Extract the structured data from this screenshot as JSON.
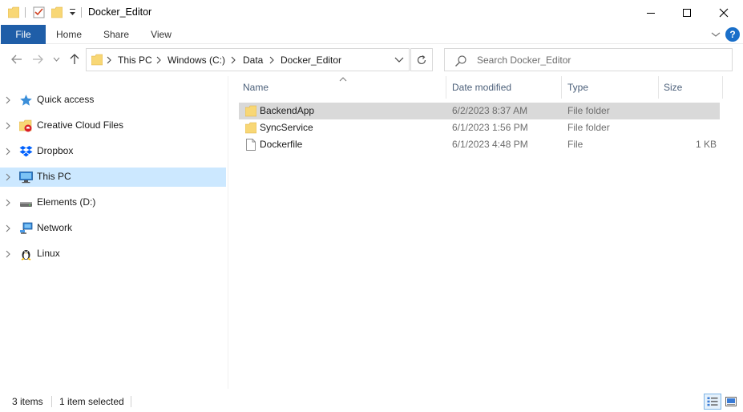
{
  "window": {
    "title": "Docker_Editor",
    "controls": {
      "minimize": "minimize-icon",
      "maximize": "maximize-icon",
      "close": "close-icon"
    }
  },
  "ribbon": {
    "tabs": [
      {
        "label": "File"
      },
      {
        "label": "Home"
      },
      {
        "label": "Share"
      },
      {
        "label": "View"
      }
    ],
    "help_label": "?"
  },
  "address": {
    "crumbs": [
      "This PC",
      "Windows (C:)",
      "Data",
      "Docker_Editor"
    ]
  },
  "search": {
    "placeholder": "Search Docker_Editor"
  },
  "navpane": {
    "items": [
      {
        "label": "Quick access",
        "icon": "quick-access-star-icon"
      },
      {
        "label": "Creative Cloud Files",
        "icon": "creative-cloud-icon"
      },
      {
        "label": "Dropbox",
        "icon": "dropbox-icon"
      },
      {
        "label": "This PC",
        "icon": "computer-icon",
        "selected": true
      },
      {
        "label": "Elements (D:)",
        "icon": "drive-icon"
      },
      {
        "label": "Network",
        "icon": "network-icon"
      },
      {
        "label": "Linux",
        "icon": "linux-penguin-icon"
      }
    ]
  },
  "filelist": {
    "columns": {
      "name": "Name",
      "date": "Date modified",
      "type": "Type",
      "size": "Size"
    },
    "rows": [
      {
        "name": "BackendApp",
        "date": "6/2/2023 8:37 AM",
        "type": "File folder",
        "size": "",
        "icon": "folder-icon",
        "selected": true
      },
      {
        "name": "SyncService",
        "date": "6/1/2023 1:56 PM",
        "type": "File folder",
        "size": "",
        "icon": "folder-icon"
      },
      {
        "name": "Dockerfile",
        "date": "6/1/2023 4:48 PM",
        "type": "File",
        "size": "1 KB",
        "icon": "file-icon"
      }
    ]
  },
  "status": {
    "item_count": "3 items",
    "selection": "1 item selected"
  },
  "colors": {
    "accent": "#1f5ea8",
    "selection_nav": "#cce8ff",
    "selection_row": "#d9d9d9",
    "folder": "#f8d775"
  }
}
